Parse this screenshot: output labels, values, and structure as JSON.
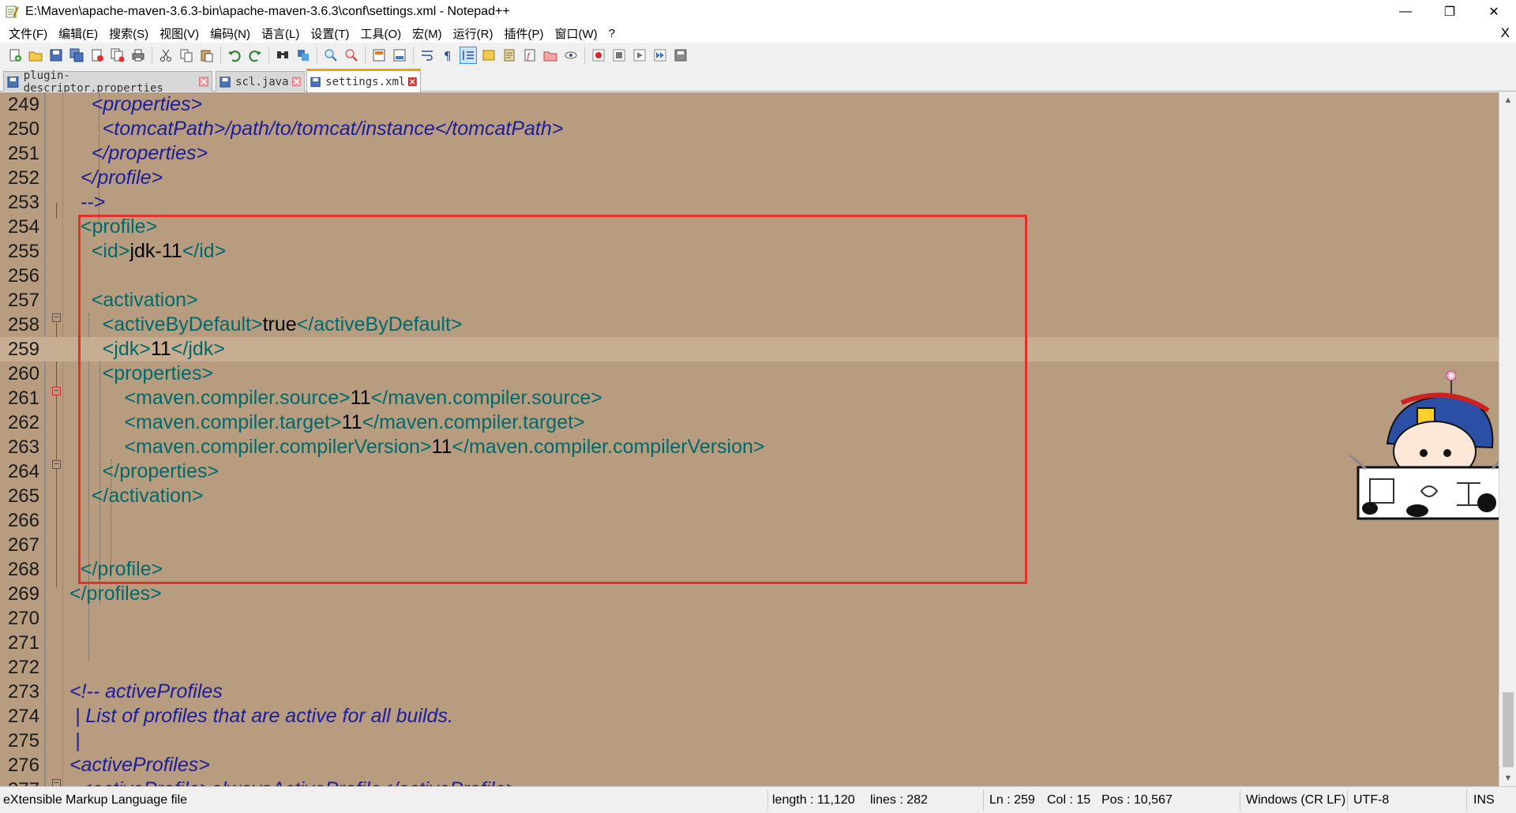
{
  "window": {
    "title": "E:\\Maven\\apache-maven-3.6.3-bin\\apache-maven-3.6.3\\conf\\settings.xml - Notepad++",
    "minimize": "—",
    "maximize": "❐",
    "close": "✕"
  },
  "menu": {
    "items": [
      "文件(F)",
      "编辑(E)",
      "搜索(S)",
      "视图(V)",
      "编码(N)",
      "语言(L)",
      "设置(T)",
      "工具(O)",
      "宏(M)",
      "运行(R)",
      "插件(P)",
      "窗口(W)",
      "?"
    ],
    "close": "X"
  },
  "tabs": [
    {
      "label": "plugin-descriptor.properties",
      "active": false
    },
    {
      "label": "scl.java",
      "active": false
    },
    {
      "label": "settings.xml",
      "active": true
    }
  ],
  "editor": {
    "current_line": 259,
    "lines": [
      {
        "n": "249",
        "parts": [
          {
            "t": "    <properties>",
            "c": "cmt"
          }
        ]
      },
      {
        "n": "250",
        "parts": [
          {
            "t": "      <tomcatPath>/path/to/tomcat/instance</tomcatPath>",
            "c": "cmt"
          }
        ]
      },
      {
        "n": "251",
        "parts": [
          {
            "t": "    </properties>",
            "c": "cmt"
          }
        ]
      },
      {
        "n": "252",
        "parts": [
          {
            "t": "  </profile>",
            "c": "cmt"
          }
        ]
      },
      {
        "n": "253",
        "parts": [
          {
            "t": "  -->",
            "c": "cmt"
          }
        ]
      },
      {
        "n": "254",
        "parts": [
          {
            "t": "  <profile>",
            "c": "tag"
          }
        ]
      },
      {
        "n": "255",
        "parts": [
          {
            "t": "    <id>",
            "c": "tag"
          },
          {
            "t": "jdk-11",
            "c": "val"
          },
          {
            "t": "</id>",
            "c": "tag"
          }
        ]
      },
      {
        "n": "256",
        "parts": []
      },
      {
        "n": "257",
        "parts": [
          {
            "t": "    <activation>",
            "c": "tag"
          }
        ]
      },
      {
        "n": "258",
        "parts": [
          {
            "t": "      <activeByDefault>",
            "c": "tag"
          },
          {
            "t": "true",
            "c": "val"
          },
          {
            "t": "</activeByDefault>",
            "c": "tag"
          }
        ]
      },
      {
        "n": "259",
        "parts": [
          {
            "t": "      <jdk>",
            "c": "tag"
          },
          {
            "t": "11",
            "c": "val"
          },
          {
            "t": "</jdk>",
            "c": "tag"
          }
        ]
      },
      {
        "n": "260",
        "parts": [
          {
            "t": "      <properties>",
            "c": "tag"
          }
        ]
      },
      {
        "n": "261",
        "parts": [
          {
            "t": "          <maven.compiler.source>",
            "c": "tag"
          },
          {
            "t": "11",
            "c": "val"
          },
          {
            "t": "</maven.compiler.source>",
            "c": "tag"
          }
        ]
      },
      {
        "n": "262",
        "parts": [
          {
            "t": "          <maven.compiler.target>",
            "c": "tag"
          },
          {
            "t": "11",
            "c": "val"
          },
          {
            "t": "</maven.compiler.target>",
            "c": "tag"
          }
        ]
      },
      {
        "n": "263",
        "parts": [
          {
            "t": "          <maven.compiler.compilerVersion>",
            "c": "tag"
          },
          {
            "t": "11",
            "c": "val"
          },
          {
            "t": "</maven.compiler.compilerVersion>",
            "c": "tag"
          }
        ]
      },
      {
        "n": "264",
        "parts": [
          {
            "t": "      </properties>",
            "c": "tag"
          }
        ]
      },
      {
        "n": "265",
        "parts": [
          {
            "t": "    </activation>",
            "c": "tag"
          }
        ]
      },
      {
        "n": "266",
        "parts": []
      },
      {
        "n": "267",
        "parts": []
      },
      {
        "n": "268",
        "parts": [
          {
            "t": "  </profile>",
            "c": "tag"
          }
        ]
      },
      {
        "n": "269",
        "parts": [
          {
            "t": "</profiles>",
            "c": "tag"
          }
        ]
      },
      {
        "n": "270",
        "parts": []
      },
      {
        "n": "271",
        "parts": []
      },
      {
        "n": "272",
        "parts": []
      },
      {
        "n": "273",
        "parts": [
          {
            "t": "<!-- activeProfiles",
            "c": "cmt"
          }
        ]
      },
      {
        "n": "274",
        "parts": [
          {
            "t": " | List of profiles that are active for all builds.",
            "c": "cmt"
          }
        ]
      },
      {
        "n": "275",
        "parts": [
          {
            "t": " |",
            "c": "cmt"
          }
        ]
      },
      {
        "n": "276",
        "parts": [
          {
            "t": "<activeProfiles>",
            "c": "cmt"
          }
        ]
      },
      {
        "n": "277",
        "parts": [
          {
            "t": "  <activeProfile>alwaysActiveProfile</activeProfile>",
            "c": "cmt"
          }
        ]
      }
    ]
  },
  "status": {
    "file_type": "eXtensible Markup Language file",
    "length": "length : 11,120",
    "lines": "lines : 282",
    "ln": "Ln : 259",
    "col": "Col : 15",
    "pos": "Pos : 10,567",
    "eol": "Windows (CR LF)",
    "encoding": "UTF-8",
    "mode": "INS"
  },
  "colors": {
    "editor_bg": "#b79c80",
    "current_line_bg": "#c7ad91",
    "tag": "#006a6a",
    "comment": "#1d1d9a",
    "highlight_box": "#e4302b"
  }
}
